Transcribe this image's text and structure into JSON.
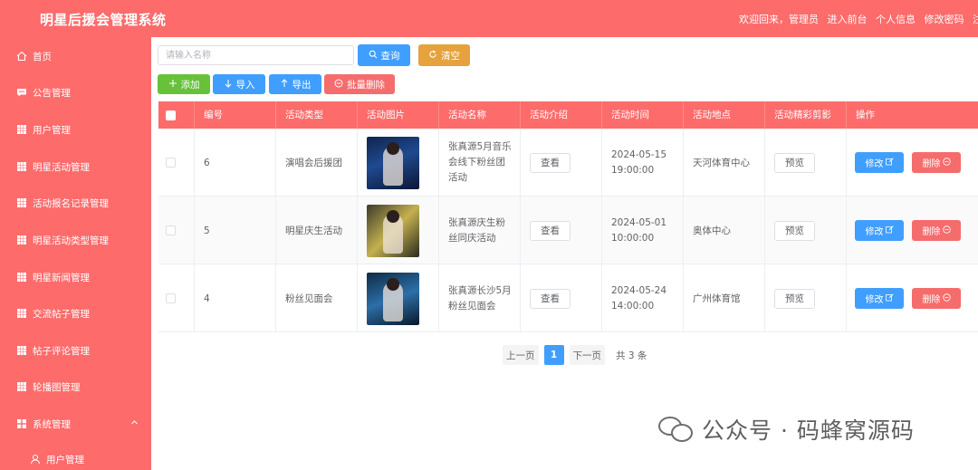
{
  "header": {
    "title": "明星后援会管理系统",
    "welcome": "欢迎回来，管理员",
    "links": [
      "进入前台",
      "个人信息",
      "修改密码",
      "注销"
    ]
  },
  "sidebar": {
    "items": [
      {
        "label": "首页",
        "icon": "home-icon"
      },
      {
        "label": "公告管理",
        "icon": "message-icon"
      },
      {
        "label": "用户管理",
        "icon": "grid-icon"
      },
      {
        "label": "明星活动管理",
        "icon": "grid-icon"
      },
      {
        "label": "活动报名记录管理",
        "icon": "grid-icon"
      },
      {
        "label": "明星活动类型管理",
        "icon": "grid-icon"
      },
      {
        "label": "明星新闻管理",
        "icon": "grid-icon"
      },
      {
        "label": "交流帖子管理",
        "icon": "grid-icon"
      },
      {
        "label": "帖子评论管理",
        "icon": "grid-icon"
      },
      {
        "label": "轮播图管理",
        "icon": "grid-icon"
      },
      {
        "label": "系统管理",
        "icon": "apps-icon"
      }
    ],
    "sub_items": [
      {
        "label": "用户管理",
        "icon": "user-icon"
      }
    ]
  },
  "search": {
    "placeholder": "请输入名称",
    "query_label": "查询",
    "reset_label": "清空"
  },
  "toolbar": {
    "add_label": "添加",
    "import_label": "导入",
    "export_label": "导出",
    "batch_delete_label": "批量删除"
  },
  "table": {
    "columns": [
      "编号",
      "活动类型",
      "活动图片",
      "活动名称",
      "活动介绍",
      "活动时间",
      "活动地点",
      "活动精彩剪影",
      "操作"
    ],
    "rows": [
      {
        "id": "6",
        "type": "演唱会后援团",
        "name": "张真源5月音乐会线下粉丝团活动",
        "intro_btn": "查看",
        "time": "2024-05-15 19:00:00",
        "place": "天河体育中心",
        "preview_btn": "预览",
        "edit_btn": "修改",
        "delete_btn": "删除"
      },
      {
        "id": "5",
        "type": "明星庆生活动",
        "name": "张真源庆生粉丝同庆活动",
        "intro_btn": "查看",
        "time": "2024-05-01 10:00:00",
        "place": "奥体中心",
        "preview_btn": "预览",
        "edit_btn": "修改",
        "delete_btn": "删除"
      },
      {
        "id": "4",
        "type": "粉丝见面会",
        "name": "张真源长沙5月粉丝见面会",
        "intro_btn": "查看",
        "time": "2024-05-24 14:00:00",
        "place": "广州体育馆",
        "preview_btn": "预览",
        "edit_btn": "修改",
        "delete_btn": "删除"
      }
    ]
  },
  "pagination": {
    "prev": "上一页",
    "current": "1",
    "next": "下一页",
    "total": "共 3 条"
  },
  "watermark": {
    "text": "公众号 · 码蜂窝源码"
  },
  "colors": {
    "primary_red": "#fd6b6b",
    "blue": "#409eff",
    "orange": "#e6a23c",
    "green": "#67c23a",
    "red": "#f56c6c"
  }
}
